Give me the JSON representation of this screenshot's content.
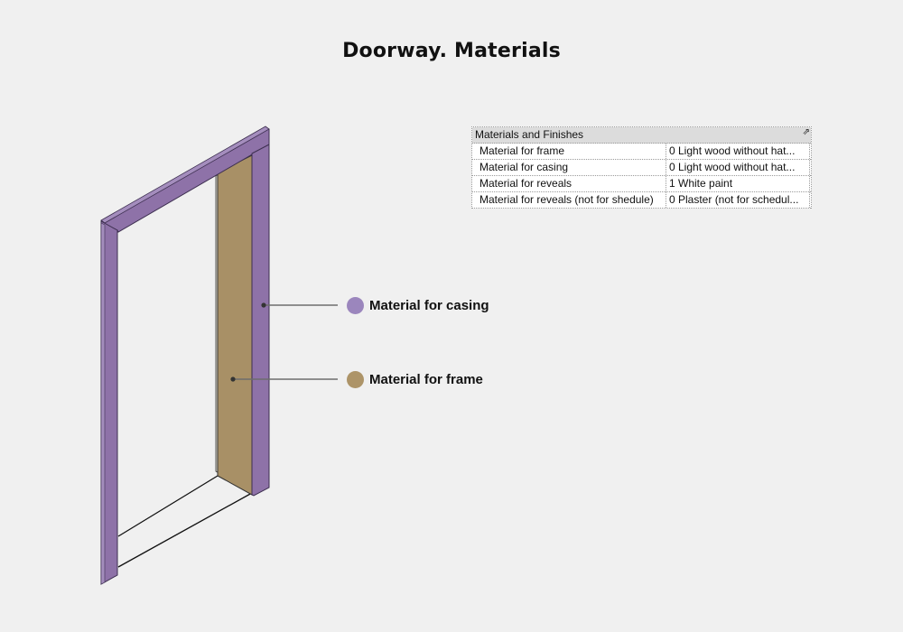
{
  "title": "Doorway. Materials",
  "properties": {
    "header": "Materials and Finishes",
    "rows": [
      {
        "name": "Material for frame",
        "value": "0 Light wood without hat..."
      },
      {
        "name": "Material for casing",
        "value": "0 Light wood without hat..."
      },
      {
        "name": "Material for reveals",
        "value": "1 White paint"
      },
      {
        "name": "Material for reveals (not for shedule)",
        "value": "0 Plaster (not for schedul..."
      }
    ]
  },
  "legend": {
    "casing": {
      "label": "Material for casing",
      "color": "#9b86bd"
    },
    "frame": {
      "label": "Material for frame",
      "color": "#ad9468"
    }
  },
  "colors": {
    "casing_fill": "#8e72a8",
    "frame_fill": "#a89066",
    "background": "#f0f0f0"
  }
}
